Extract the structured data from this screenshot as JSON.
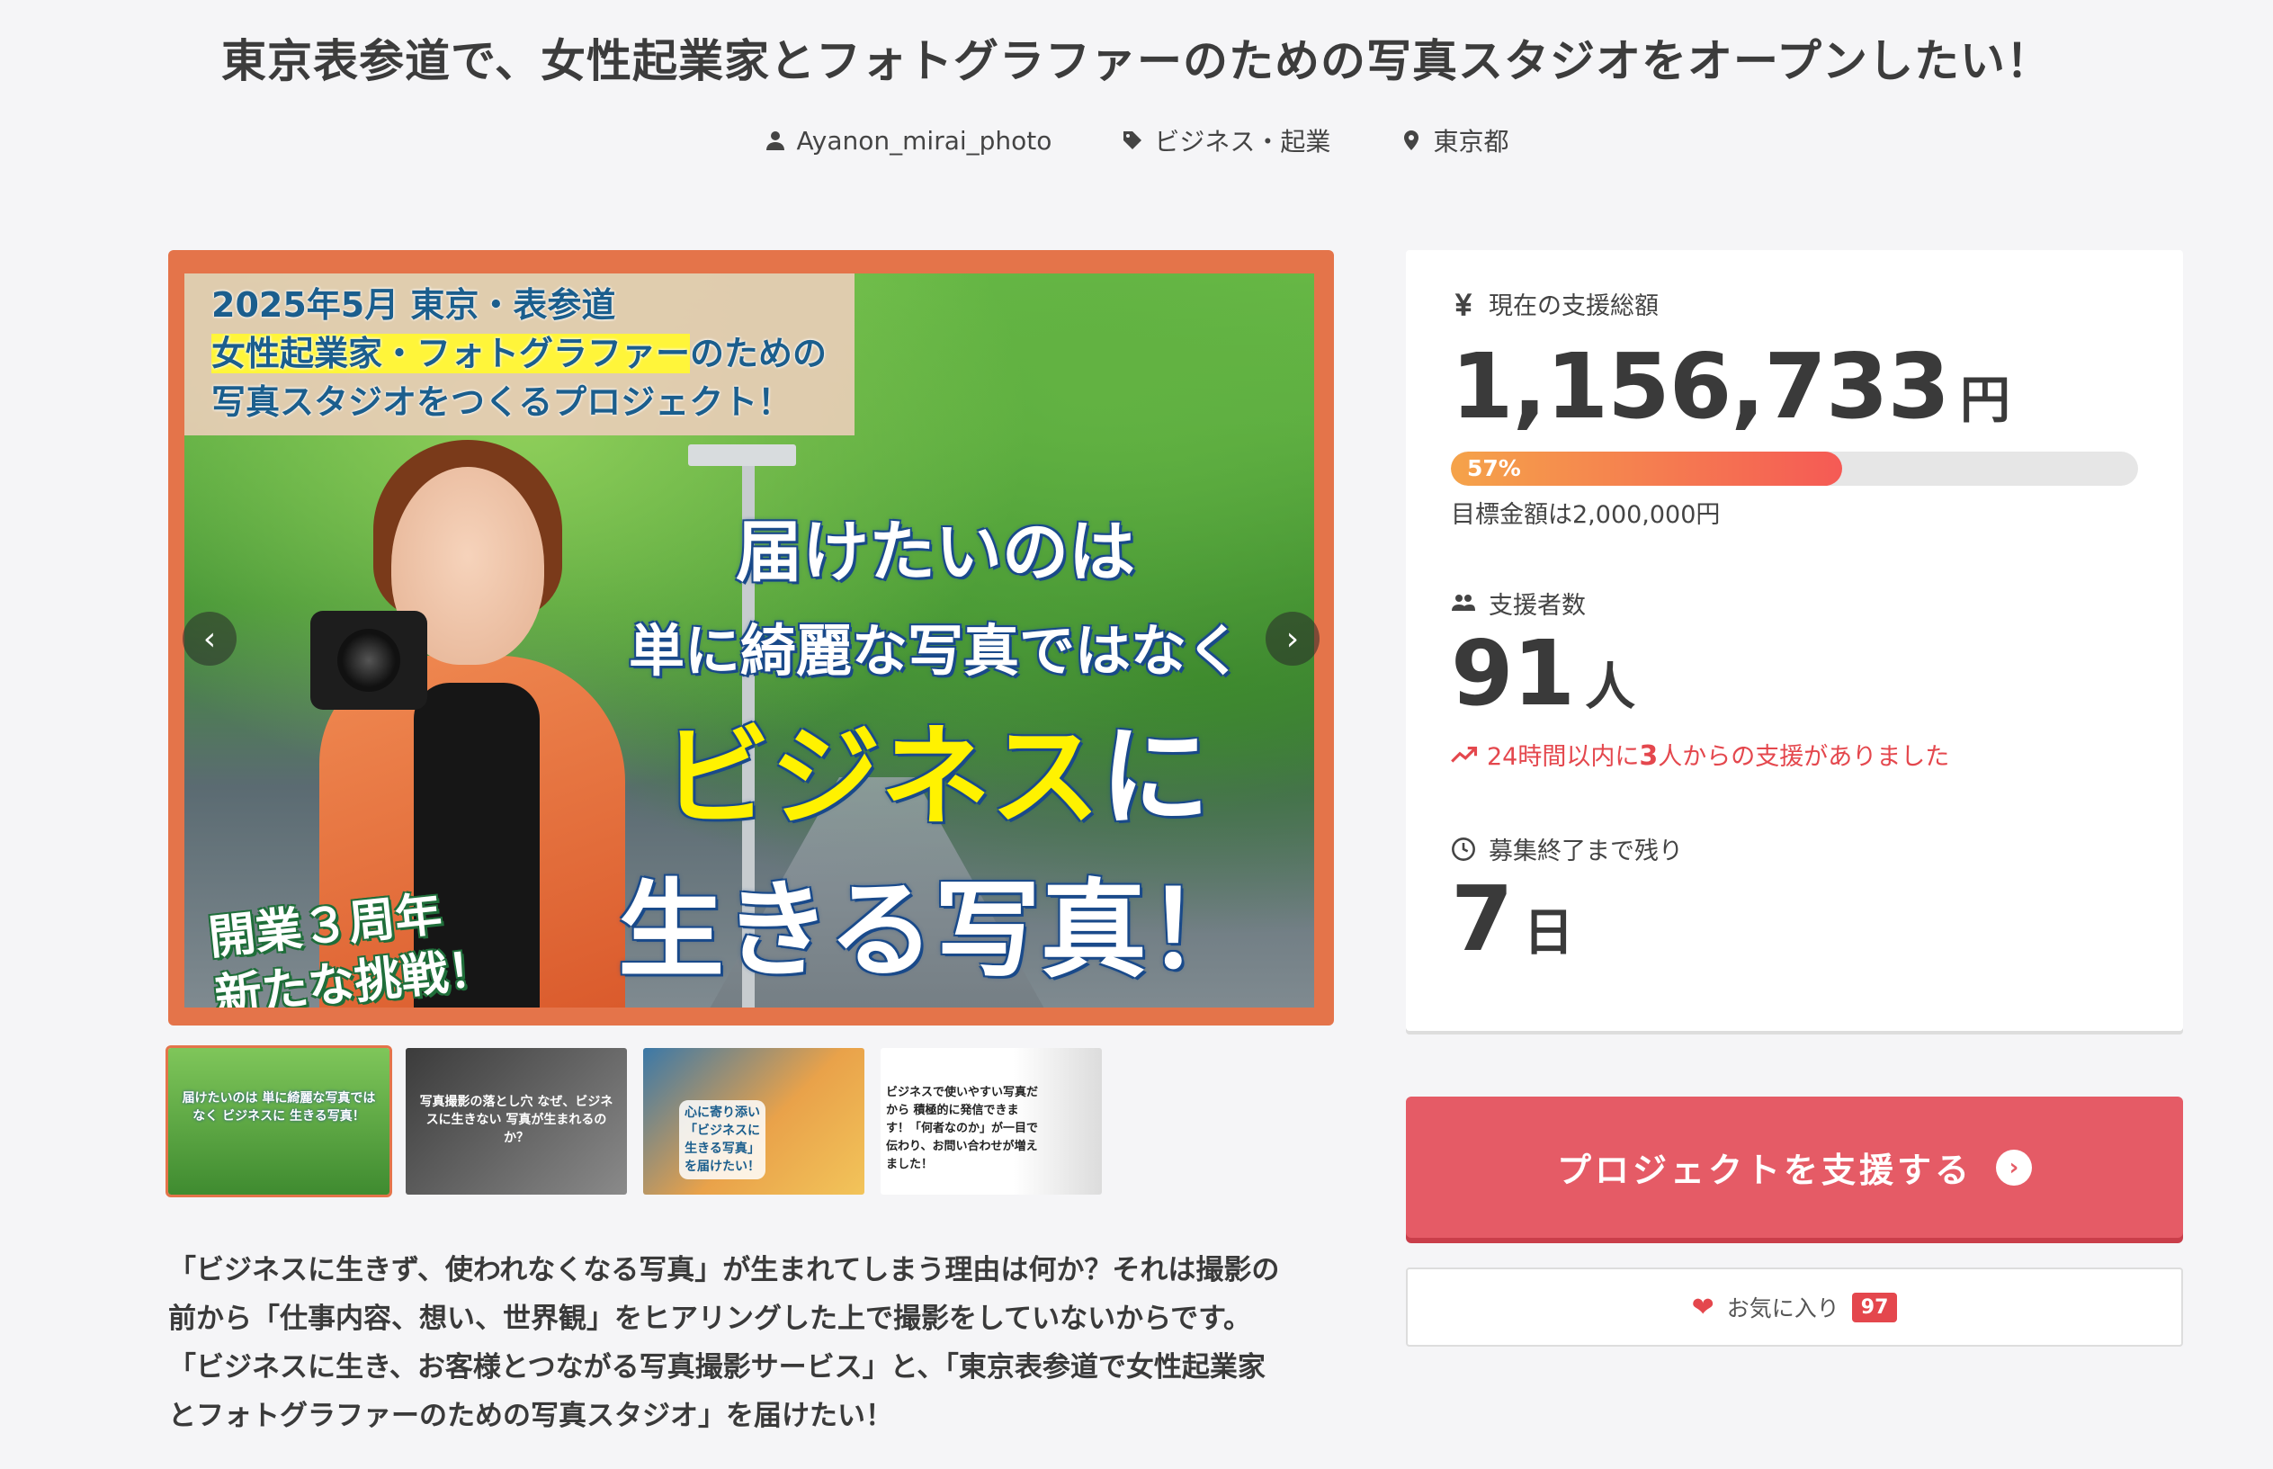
{
  "title": "東京表参道で、女性起業家とフォトグラファーのための写真スタジオをオープンしたい！",
  "meta": {
    "author": "Ayanon_mirai_photo",
    "category": "ビジネス・起業",
    "location": "東京都"
  },
  "hero": {
    "banner_line1": "2025年5月 東京・表参道",
    "banner_line2_hl": "女性起業家・フォトグラファー",
    "banner_line2_rest": "のための",
    "banner_line3": "写真スタジオをつくるプロジェクト！",
    "headline_1": "届けたいのは",
    "headline_2": "単に綺麗な写真ではなく",
    "headline_3a": "ビジネス",
    "headline_3b": "に",
    "headline_4": "生きる写真！",
    "anniv_1": "開業３周年",
    "anniv_2": "新たな挑戦！",
    "prev": "‹",
    "next": "›"
  },
  "thumbs": [
    {
      "text": "届けたいのは 単に綺麗な写真ではなく ビジネスに 生きる写真！"
    },
    {
      "text": "写真撮影の落とし穴 なぜ、ビジネスに生きない 写真が生まれるのか？"
    },
    {
      "text": "心に寄り添い「ビジネスに生きる写真」を届けたい！"
    },
    {
      "text": "ビジネスで使いやすい写真だから 積極的に発信できます！「何者なのか」が一目で伝わり、お問い合わせが増えました！"
    }
  ],
  "description": {
    "line1": "「ビジネスに生きず、使われなくなる写真」が生まれてしまう理由は何か？それは撮影の",
    "line2": "前から「仕事内容、想い、世界観」をヒアリングした上で撮影をしていないからです。",
    "line3": "「ビジネスに生き、お客様とつながる写真撮影サービス」と、「東京表参道で女性起業家",
    "line4": "とフォトグラファーのための写真スタジオ」を届けたい！"
  },
  "panel": {
    "amount_label": "現在の支援総額",
    "amount": "1,156,733",
    "amount_unit": "円",
    "progress_label": "57%",
    "progress": 0.57,
    "goal": "目標金額は2,000,000円",
    "backers_label": "支援者数",
    "backers": "91",
    "backers_unit": "人",
    "recent_pre": "24時間以内に",
    "recent_num": "3",
    "recent_post": "人からの支援がありました",
    "remaining_label": "募集終了まで残り",
    "remaining": "7",
    "remaining_unit": "日"
  },
  "support_button": "プロジェクトを支援する",
  "favorite": {
    "label": "お気に入り",
    "count": "97"
  },
  "colors": {
    "accent": "#e55b66",
    "alert": "#e4474d",
    "hero_frame": "#e4744a"
  }
}
